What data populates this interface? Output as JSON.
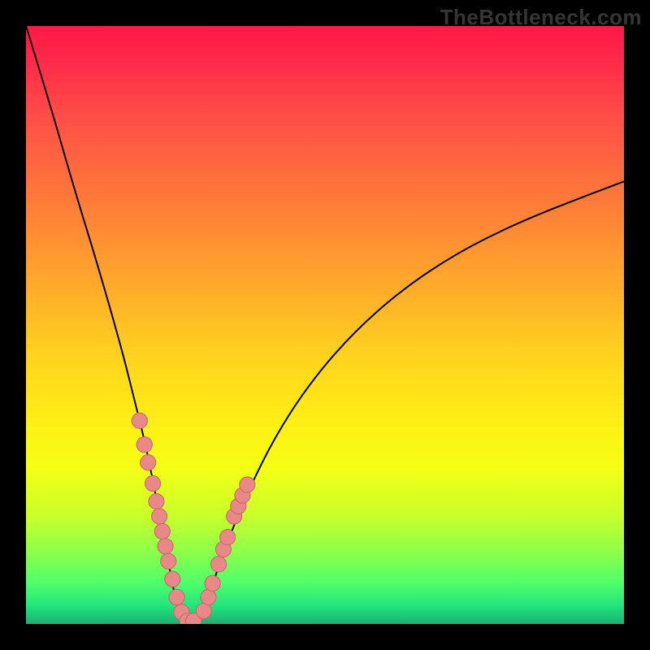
{
  "watermark": "TheBottleneck.com",
  "colors": {
    "curve_stroke": "#000000",
    "marker_fill": "#e98888",
    "marker_stroke": "#c96b6b",
    "gradient": [
      "#ff1846",
      "#ff6a3e",
      "#ffd21e",
      "#f4ff15",
      "#50ff6a",
      "#1cae70"
    ]
  },
  "chart_data": {
    "type": "line",
    "title": "",
    "xlabel": "",
    "ylabel": "",
    "xlim": [
      0,
      100
    ],
    "ylim": [
      0,
      100
    ],
    "grid": false,
    "legend": null,
    "series": [
      {
        "name": "bottleneck-curve",
        "x": [
          0,
          4,
          8,
          12,
          16,
          18,
          20,
          22,
          23.5,
          25,
          26,
          27,
          28,
          30,
          33,
          37,
          42,
          48,
          55,
          63,
          72,
          82,
          92,
          100
        ],
        "y": [
          100,
          87,
          73,
          60,
          46,
          38,
          30,
          20,
          12,
          4,
          1,
          0,
          0,
          3,
          12,
          22,
          32,
          41,
          49,
          56,
          62,
          67,
          71,
          74
        ]
      }
    ],
    "markers": {
      "name": "highlight-points",
      "x": [
        19.0,
        19.8,
        20.4,
        21.2,
        21.8,
        22.3,
        22.8,
        23.3,
        23.8,
        24.5,
        25.2,
        26.0,
        27.0,
        28.0,
        29.7,
        30.5,
        31.2,
        32.2,
        33.0,
        33.7,
        34.8,
        35.5,
        36.2,
        37.0
      ],
      "y": [
        34,
        30,
        27,
        23.5,
        20.5,
        18,
        15.5,
        13,
        10.5,
        7.5,
        4.5,
        2,
        0.5,
        0.5,
        2.2,
        4.5,
        6.8,
        10,
        12.5,
        14.5,
        18,
        19.7,
        21.5,
        23.3
      ]
    }
  }
}
